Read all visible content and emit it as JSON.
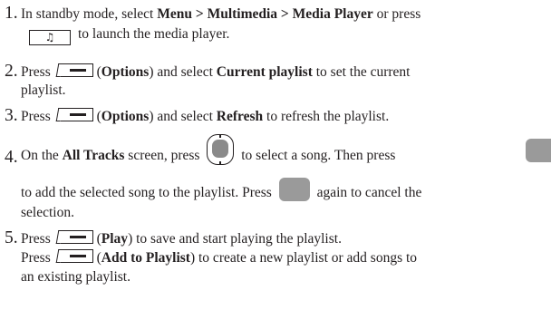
{
  "steps": [
    {
      "num": "1.",
      "l1_a": "In standby mode, select ",
      "l1_b": "Menu > Multimedia > Media Player",
      "l1_c": " or press",
      "l2_icon": "music-note-icon",
      "l2_glyph": "♫",
      "l2_a": "to launch the media player."
    },
    {
      "num": "2.",
      "l1_a": "Press ",
      "l1_b": "(",
      "l1_c": "Options",
      "l1_d": ") and select ",
      "l1_e": "Current playlist",
      "l1_f": " to set the current",
      "l2_a": "playlist."
    },
    {
      "num": "3.",
      "l1_a": "Press ",
      "l1_b": "(",
      "l1_c": "Options",
      "l1_d": ") and select ",
      "l1_e": "Refresh",
      "l1_f": " to refresh the playlist."
    },
    {
      "num": "4.",
      "l1_a": "On the ",
      "l1_b": "All Tracks",
      "l1_c": " screen, press ",
      "l1_d": " to select a song. Then press",
      "l2_a": "to add the selected song to the playlist. Press ",
      "l2_b": " again to cancel the",
      "l3_a": "selection."
    },
    {
      "num": "5.",
      "l1_a": "Press ",
      "l1_b": "(",
      "l1_c": "Play",
      "l1_d": ") to save and start playing the playlist.",
      "l2_a": "Press ",
      "l2_b": "(",
      "l2_c": "Add to Playlist",
      "l2_d": ") to create a new playlist or add songs to",
      "l3_a": "an existing playlist."
    }
  ]
}
